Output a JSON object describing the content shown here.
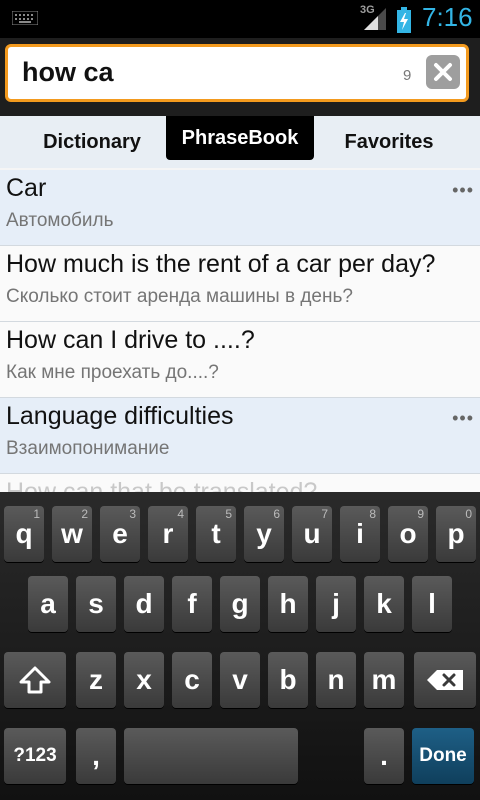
{
  "status_bar": {
    "network": "3G",
    "time": "7:16"
  },
  "search": {
    "query": "how ca",
    "count": "9"
  },
  "tabs": [
    {
      "label": "Dictionary"
    },
    {
      "label": "PhraseBook"
    },
    {
      "label": "Favorites"
    }
  ],
  "list": [
    {
      "title": "Car",
      "subtitle": "Автомобиль",
      "kind": "category"
    },
    {
      "title": "How much is the rent of a car per day?",
      "subtitle": "Сколько стоит аренда машины в день?",
      "kind": "phrase"
    },
    {
      "title": "How can I drive to ....?",
      "subtitle": "Как мне проехать до....?",
      "kind": "phrase"
    },
    {
      "title": "Language difficulties",
      "subtitle": "Взаимопонимание",
      "kind": "category"
    },
    {
      "title": "How can that be translated?",
      "subtitle": "",
      "kind": "phrase"
    }
  ],
  "keyboard": {
    "row1": [
      {
        "k": "q",
        "h": "1"
      },
      {
        "k": "w",
        "h": "2"
      },
      {
        "k": "e",
        "h": "3"
      },
      {
        "k": "r",
        "h": "4"
      },
      {
        "k": "t",
        "h": "5"
      },
      {
        "k": "y",
        "h": "6"
      },
      {
        "k": "u",
        "h": "7"
      },
      {
        "k": "i",
        "h": "8"
      },
      {
        "k": "o",
        "h": "9"
      },
      {
        "k": "p",
        "h": "0"
      }
    ],
    "row2": [
      "a",
      "s",
      "d",
      "f",
      "g",
      "h",
      "j",
      "k",
      "l"
    ],
    "row3": [
      "z",
      "x",
      "c",
      "v",
      "b",
      "n",
      "m"
    ],
    "symbols_label": "?123",
    "comma": ",",
    "period": ".",
    "done_label": "Done"
  }
}
